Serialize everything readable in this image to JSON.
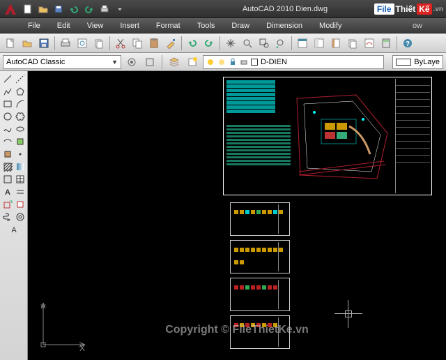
{
  "app": {
    "title": "AutoCAD 2010     Dien.dwg",
    "watermark": {
      "file": "File",
      "thiet": "Thiết",
      "ke": "Kế",
      "vn": ".vn"
    }
  },
  "menu": {
    "items": [
      "File",
      "Edit",
      "View",
      "Insert",
      "Format",
      "Tools",
      "Draw",
      "Dimension",
      "Modify"
    ],
    "overflow": "ow"
  },
  "toolbar": {
    "icons": [
      "new",
      "open",
      "save",
      "saveas",
      "plot",
      "publish",
      "cut",
      "copy",
      "paste",
      "matchprop",
      "undo",
      "redo",
      "pan",
      "zoom-ext",
      "zoom-win",
      "zoom-prev",
      "properties",
      "dc",
      "tool-palettes",
      "sheetset",
      "markup",
      "calc",
      "help"
    ]
  },
  "workspace": {
    "current": "AutoCAD Classic"
  },
  "layer": {
    "current": "D-DIEN",
    "bylayer": "ByLaye",
    "color": "#ffffff"
  },
  "palette": {
    "tools": [
      [
        "line",
        "pline"
      ],
      [
        "arc",
        "circle"
      ],
      [
        "revcloud",
        "spline"
      ],
      [
        "ellipse",
        "ellipse-arc"
      ],
      [
        "rectangle",
        "polygon"
      ],
      [
        "hatch",
        "gradient"
      ],
      [
        "region",
        "table"
      ],
      [
        "mtext",
        "mline"
      ],
      [
        "point",
        "divide"
      ],
      [
        "block",
        "insert"
      ],
      [
        "donut",
        "boundary"
      ],
      [
        "helix",
        "3dpoly"
      ],
      [
        "text",
        "dtext"
      ]
    ]
  },
  "canvas": {
    "ucs": {
      "x": "X",
      "y": "Y"
    },
    "copyright": "Copyright © FileThietKe.vn"
  },
  "colors": {
    "accent": "#b01e2e",
    "cyan": "#00ffff",
    "green": "#22aa66",
    "red_line": "#b01e2e"
  }
}
